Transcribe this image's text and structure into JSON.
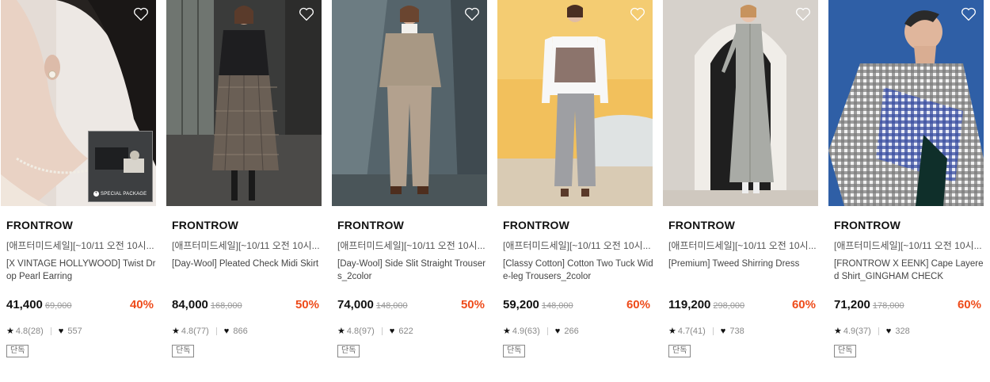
{
  "products": [
    {
      "brand": "FRONTROW",
      "promo": "[애프터미드세일][~10/11 오전 10시...",
      "name": "[X VINTAGE HOLLYWOOD] Twist Drop Pearl Earring",
      "price": "41,400",
      "original_price": "69,000",
      "discount": "40%",
      "rating": "4.8(28)",
      "likes": "557",
      "badge": "단독",
      "package_label": "SPECIAL PACKAGE"
    },
    {
      "brand": "FRONTROW",
      "promo": "[애프터미드세일][~10/11 오전 10시...",
      "name": "[Day-Wool] Pleated Check Midi Skirt",
      "price": "84,000",
      "original_price": "168,000",
      "discount": "50%",
      "rating": "4.8(77)",
      "likes": "866",
      "badge": "단독"
    },
    {
      "brand": "FRONTROW",
      "promo": "[애프터미드세일][~10/11 오전 10시...",
      "name": "[Day-Wool] Side Slit Straight Trousers_2color",
      "price": "74,000",
      "original_price": "148,000",
      "discount": "50%",
      "rating": "4.8(97)",
      "likes": "622",
      "badge": "단독"
    },
    {
      "brand": "FRONTROW",
      "promo": "[애프터미드세일][~10/11 오전 10시...",
      "name": "[Classy Cotton] Cotton Two Tuck Wide-leg Trousers_2color",
      "price": "59,200",
      "original_price": "148,000",
      "discount": "60%",
      "rating": "4.9(63)",
      "likes": "266",
      "badge": "단독"
    },
    {
      "brand": "FRONTROW",
      "promo": "[애프터미드세일][~10/11 오전 10시...",
      "name": "[Premium] Tweed Shirring Dress",
      "price": "119,200",
      "original_price": "298,000",
      "discount": "60%",
      "rating": "4.7(41)",
      "likes": "738",
      "badge": "단독"
    },
    {
      "brand": "FRONTROW",
      "promo": "[애프터미드세일][~10/11 오전 10시...",
      "name": "[FRONTROW X EENK] Cape Layered Shirt_GINGHAM CHECK",
      "price": "71,200",
      "original_price": "178,000",
      "discount": "60%",
      "rating": "4.9(37)",
      "likes": "328",
      "badge": "단독"
    }
  ],
  "icons": {
    "wishlist": "heart-outline-icon",
    "rating": "star-icon",
    "likes": "heart-filled-icon"
  },
  "colors": {
    "discount": "#ee4b1a",
    "text": "#111111",
    "muted": "#888888"
  }
}
